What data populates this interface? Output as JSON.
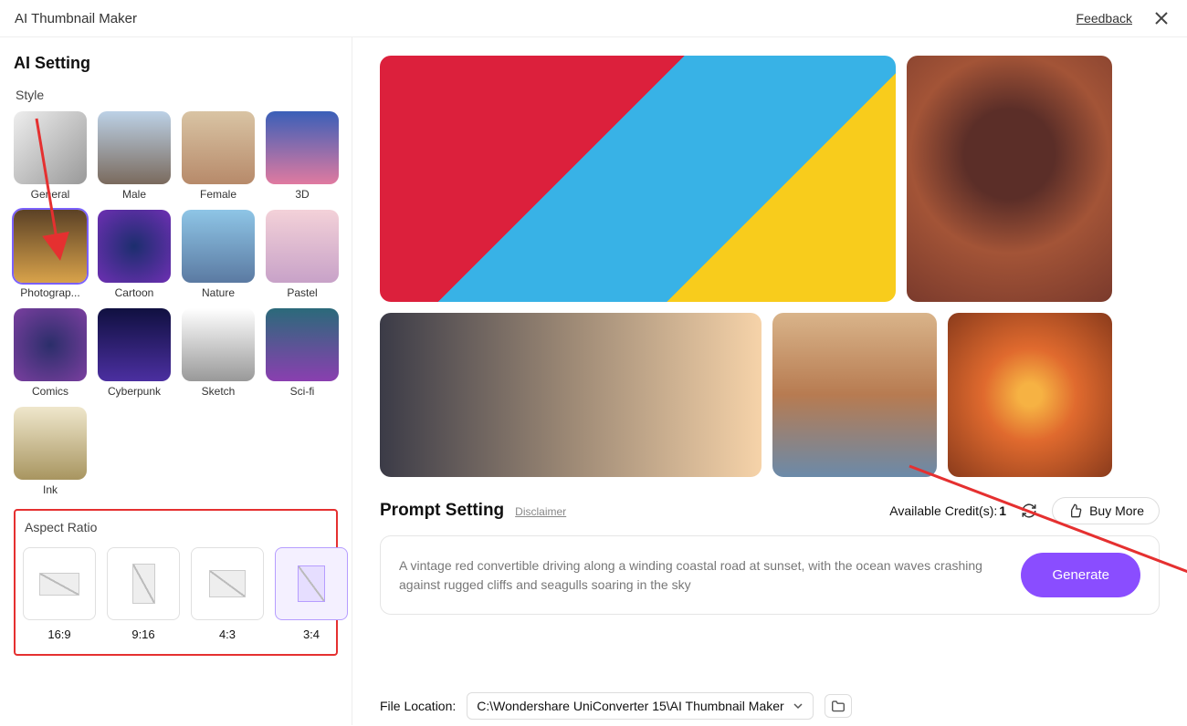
{
  "header": {
    "title": "AI Thumbnail Maker",
    "feedback": "Feedback"
  },
  "sidebar": {
    "heading": "AI Setting",
    "style_label": "Style",
    "styles": [
      {
        "label": "General",
        "cls": "t-general",
        "selected": false
      },
      {
        "label": "Male",
        "cls": "t-male",
        "selected": false
      },
      {
        "label": "Female",
        "cls": "t-female",
        "selected": false
      },
      {
        "label": "3D",
        "cls": "t-3d",
        "selected": false
      },
      {
        "label": "Photograp...",
        "cls": "t-photo",
        "selected": true
      },
      {
        "label": "Cartoon",
        "cls": "t-cartoon",
        "selected": false
      },
      {
        "label": "Nature",
        "cls": "t-nature",
        "selected": false
      },
      {
        "label": "Pastel",
        "cls": "t-pastel",
        "selected": false
      },
      {
        "label": "Comics",
        "cls": "t-comics",
        "selected": false
      },
      {
        "label": "Cyberpunk",
        "cls": "t-cyber",
        "selected": false
      },
      {
        "label": "Sketch",
        "cls": "t-sketch",
        "selected": false
      },
      {
        "label": "Sci-fi",
        "cls": "t-scifi",
        "selected": false
      },
      {
        "label": "Ink",
        "cls": "t-ink",
        "selected": false
      }
    ],
    "aspect_label": "Aspect Ratio",
    "ratios": [
      {
        "label": "16:9",
        "shape": "r169",
        "selected": false
      },
      {
        "label": "9:16",
        "shape": "r916",
        "selected": false
      },
      {
        "label": "4:3",
        "shape": "r43",
        "selected": false
      },
      {
        "label": "3:4",
        "shape": "r34",
        "selected": true
      }
    ]
  },
  "prompt": {
    "heading": "Prompt Setting",
    "disclaimer": "Disclaimer",
    "credits_label": "Available Credit(s):",
    "credits_value": "1",
    "buy_more": "Buy More",
    "text": "A vintage red convertible driving along a winding coastal road at sunset, with the ocean waves crashing against rugged cliffs and seagulls soaring in the sky",
    "generate": "Generate"
  },
  "file": {
    "label": "File Location:",
    "value": "C:\\Wondershare UniConverter 15\\AI Thumbnail Maker"
  }
}
